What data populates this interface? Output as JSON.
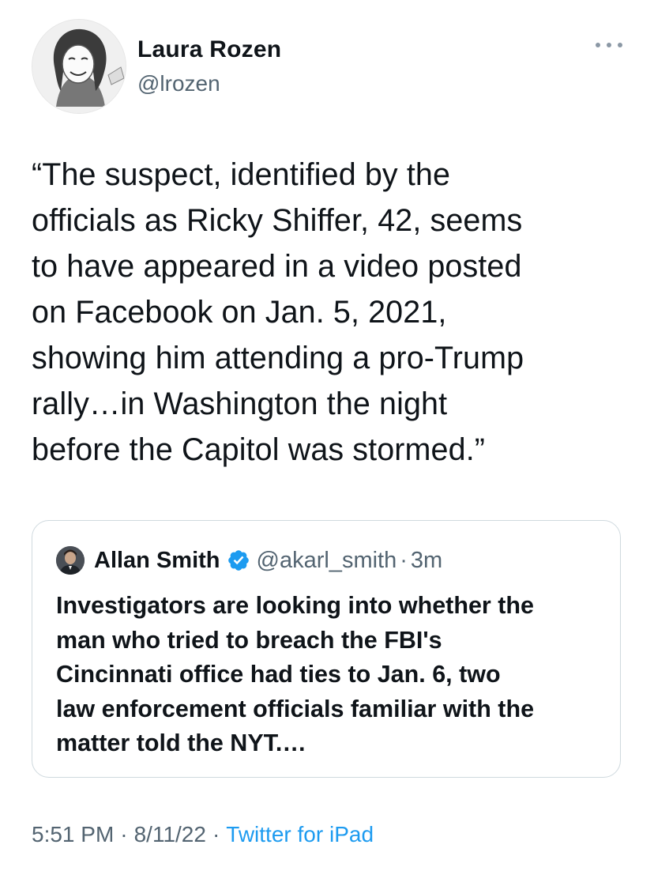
{
  "author": {
    "name": "Laura Rozen",
    "handle": "@lrozen"
  },
  "tweet": {
    "text": "“The suspect, identified by the\nofficials as Ricky Shiffer, 42, seems\nto have appeared in a video posted\non Facebook on Jan. 5, 2021,\nshowing him attending a pro-Trump\nrally…in Washington the night\nbefore the Capitol was stormed.”"
  },
  "quoted_tweet": {
    "name": "Allan Smith",
    "handle": "@akarl_smith",
    "separator": "·",
    "time": "3m",
    "text": "Investigators are looking into whether the\nman who tried to breach the FBI's\nCincinnati office had ties to Jan. 6, two\nlaw enforcement officials familiar with the\nmatter told the NYT.…",
    "verified": true
  },
  "meta": {
    "time": "5:51 PM",
    "separator1": "·",
    "date": "8/11/22",
    "separator2": "·",
    "source": "Twitter for iPad"
  },
  "colors": {
    "text": "#0f1419",
    "secondary": "#536471",
    "accent": "#1d9bf0",
    "border": "#cfd9de"
  },
  "icons": {
    "more": "more-horizontal-icon",
    "verified": "verified-badge-icon"
  }
}
